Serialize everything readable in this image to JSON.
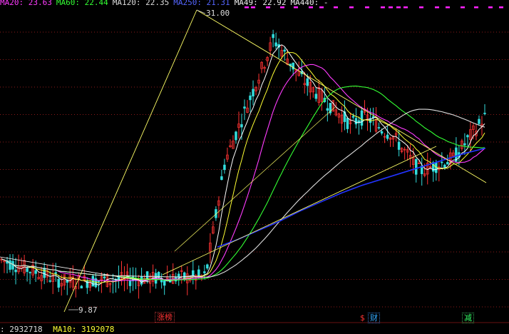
{
  "ma_header": {
    "items": [
      {
        "label": "MA20: 23.63",
        "color": "#ff3cff"
      },
      {
        "label": "MA60: 22.44",
        "color": "#33ff33"
      },
      {
        "label": "MA120: 22.35",
        "color": "#dddddd"
      },
      {
        "label": "MA250: 21.31",
        "color": "#5566ff"
      },
      {
        "label": "MA49: 22.92",
        "color": "#eeeeee"
      },
      {
        "label": "MA440: -",
        "color": "#eeeeee"
      }
    ]
  },
  "annotations": {
    "high_price": "31.00",
    "low_price": "9.87"
  },
  "events": {
    "limit_up": "涨榜",
    "finance_mark": "$",
    "finance": "财",
    "reduce": "减"
  },
  "volume_header": {
    "vol": ": 2932718",
    "ma10": "MA10: 3192078"
  },
  "colors": {
    "background": "#000000",
    "candle_up": "#ff3333",
    "candle_down": "#33dddd",
    "ma5": "#ffffff",
    "ma10": "#ffff33",
    "ma20": "#ff3cff",
    "ma60": "#33ff33",
    "ma120": "#dddddd",
    "ma250": "#2233ff",
    "trendline": "#ffff66",
    "grid": "#8b1a1a"
  },
  "chart_data": {
    "type": "line",
    "title": "",
    "series": [
      {
        "name": "MA20",
        "values": [
          12.4,
          12.1,
          11.6,
          11.2,
          11.0,
          11.3,
          12.5,
          15.8,
          19.7,
          23.2,
          25.8,
          26.6,
          26.4,
          25.3,
          24.6,
          24.0,
          23.7,
          23.2,
          22.5,
          22.6,
          22.9,
          23.3,
          23.6
        ]
      },
      {
        "name": "MA60",
        "values": [
          12.1,
          11.9,
          11.6,
          11.3,
          11.1,
          11.1,
          11.5,
          12.6,
          14.6,
          17.8,
          21.0,
          23.6,
          25.2,
          25.5,
          25.0,
          24.2,
          23.7,
          23.2,
          22.6,
          22.4,
          22.4,
          22.4,
          22.4
        ]
      },
      {
        "name": "MA250",
        "values": [
          null,
          null,
          null,
          null,
          null,
          null,
          null,
          null,
          null,
          13.6,
          14.2,
          14.9,
          15.6,
          16.4,
          17.1,
          17.8,
          18.4,
          18.9,
          19.4,
          19.9,
          20.4,
          20.9,
          21.3
        ]
      }
    ],
    "ylim": [
      8.5,
      32
    ]
  }
}
